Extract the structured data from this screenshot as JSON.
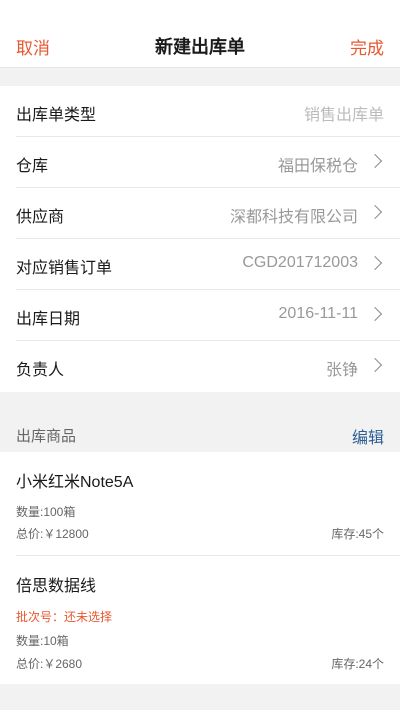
{
  "nav": {
    "cancel": "取消",
    "title": "新建出库单",
    "done": "完成"
  },
  "form": {
    "rows": [
      {
        "label": "出库单类型",
        "value": "销售出库单"
      },
      {
        "label": "仓库",
        "value": "福田保税仓"
      },
      {
        "label": "供应商",
        "value": "深都科技有限公司"
      },
      {
        "label": "对应销售订单",
        "value": "CGD201712003"
      },
      {
        "label": "出库日期",
        "value": "2016-11-11"
      },
      {
        "label": "负责人",
        "value": "张铮"
      }
    ]
  },
  "products_section": {
    "title": "出库商品",
    "edit": "编辑"
  },
  "products": [
    {
      "name": "小米红米Note5A",
      "quantity": "数量:100箱",
      "total": "总价:￥12800",
      "stock": "库存:45个"
    },
    {
      "name": "倍思数据线",
      "batch": "批次号：还未选择",
      "quantity": "数量:10箱",
      "total": "总价:￥2680",
      "stock": "库存:24个"
    }
  ],
  "colors": {
    "accent": "#e8572f",
    "link": "#2c5e96"
  }
}
